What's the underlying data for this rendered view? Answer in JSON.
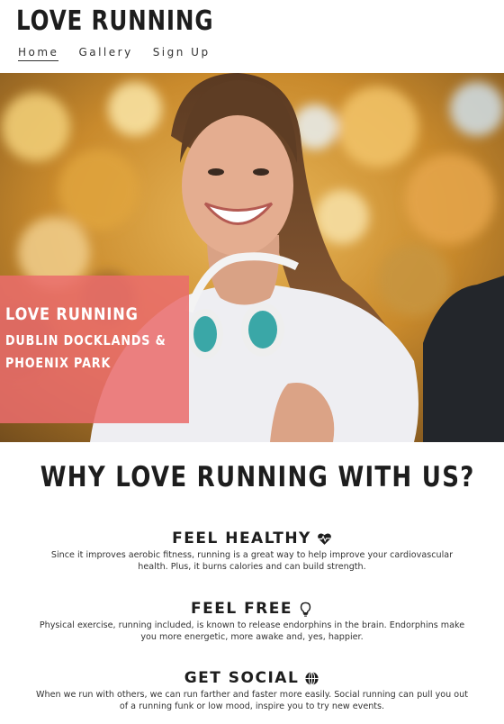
{
  "header": {
    "brand": "LOVE RUNNING",
    "nav": [
      {
        "label": "Home",
        "active": true
      },
      {
        "label": "Gallery",
        "active": false
      },
      {
        "label": "Sign Up",
        "active": false
      }
    ]
  },
  "hero": {
    "line1": "LOVE RUNNING",
    "line2": "DUBLIN DOCKLANDS &",
    "line3": "PHOENIX PARK",
    "overlay_color": "#ea6c6c"
  },
  "why": {
    "heading": "WHY LOVE RUNNING WITH US?"
  },
  "features": [
    {
      "title": "FEEL HEALTHY",
      "icon": "heartbeat-icon",
      "text": "Since it improves aerobic fitness, running is a great way to help improve your cardiovascular health. Plus, it burns calories and can build strength."
    },
    {
      "title": "FEEL FREE",
      "icon": "lightbulb-icon",
      "text": "Physical exercise, running included, is known to release endorphins in the brain. Endorphins make you more energetic, more awake and, yes, happier."
    },
    {
      "title": "GET SOCIAL",
      "icon": "globe-icon",
      "text": "When we run with others, we can run farther and faster more easily. Social running can pull you out of a running funk or low mood, inspire you to try new events."
    }
  ]
}
